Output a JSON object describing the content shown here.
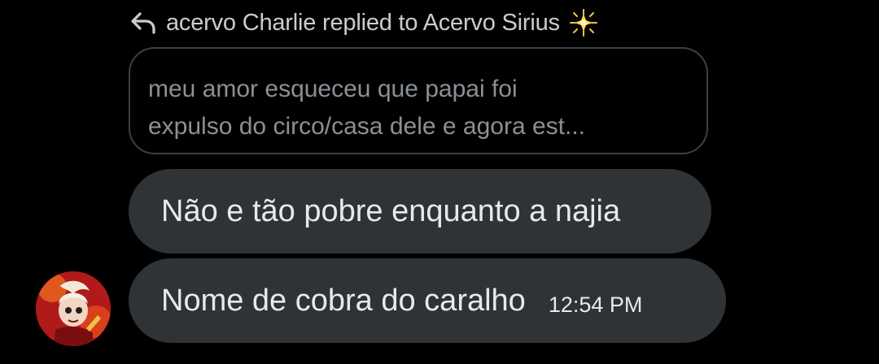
{
  "reply_header": {
    "text": "acervo Charlie replied to Acervo Sirius",
    "reply_icon": "reply-arrow-icon",
    "emoji_icon": "sparkle-star-icon"
  },
  "quoted_message": {
    "line1": "meu amor esqueceu que papai foi",
    "line2": "expulso do circo/casa dele e agora est..."
  },
  "messages": [
    {
      "text": "Não e tão pobre enquanto a najia"
    },
    {
      "text": "Nome de cobra do caralho",
      "time": "12:54 PM"
    }
  ],
  "sender": {
    "avatar_icon": "avatar-image"
  },
  "colors": {
    "background": "#000000",
    "bubble": "#2f3336",
    "quote_border": "#3b4045",
    "text_primary": "#e7e9ea",
    "text_muted": "#8b9095"
  }
}
